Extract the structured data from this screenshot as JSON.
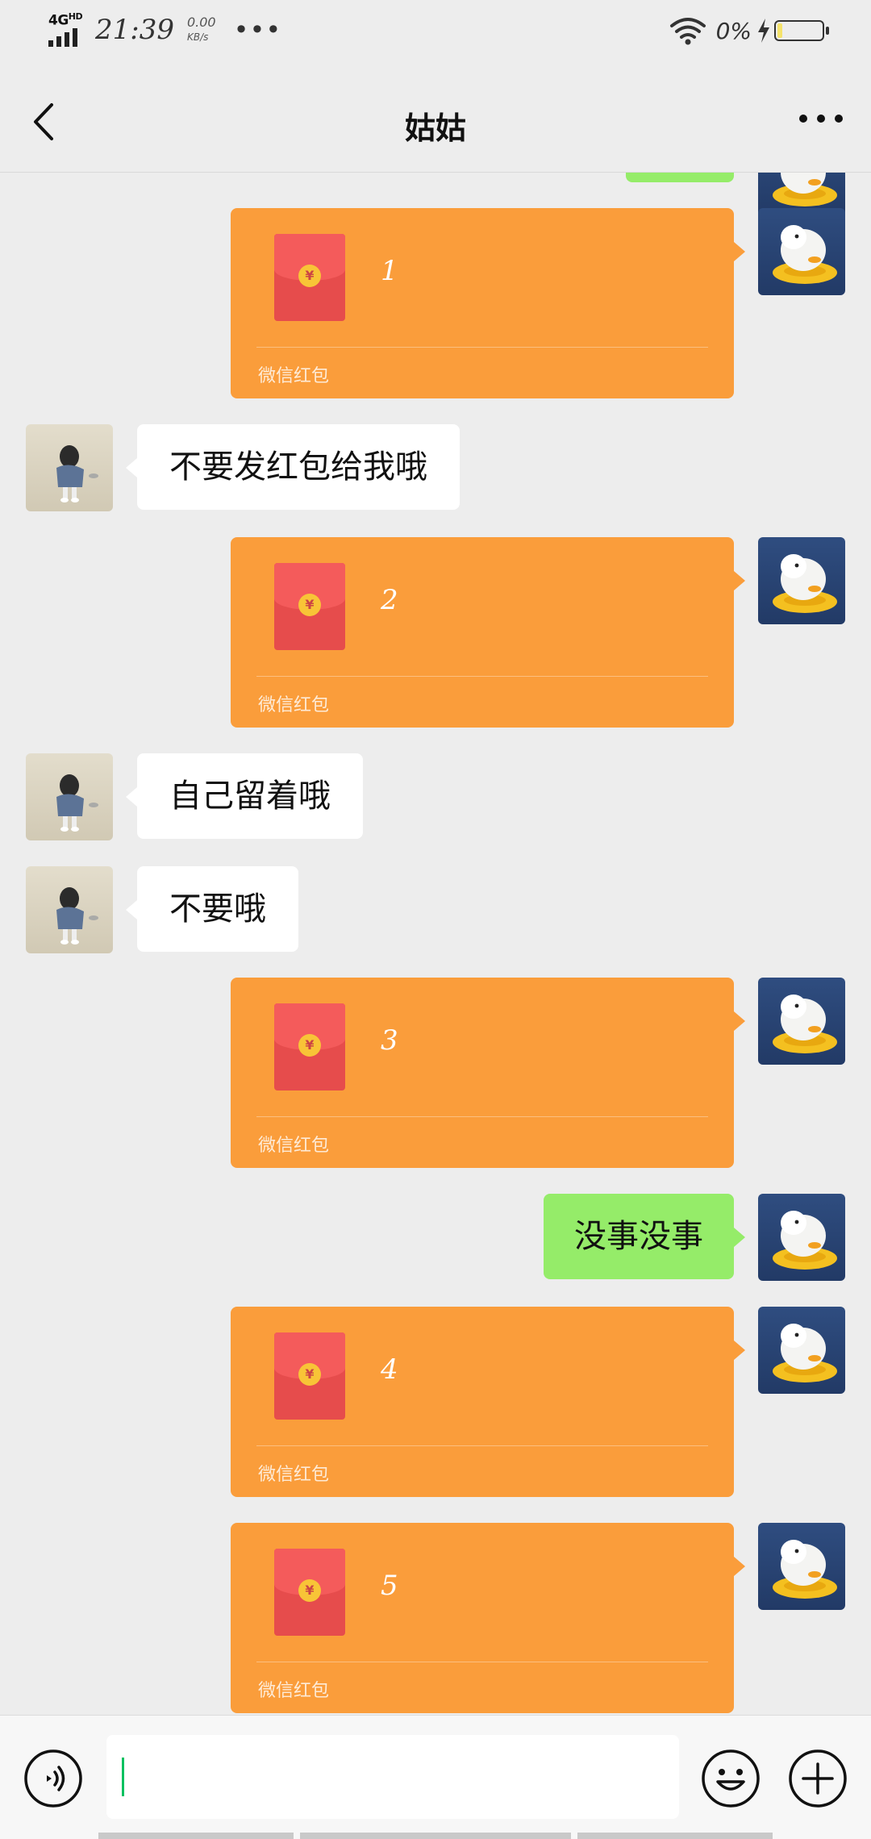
{
  "status_bar": {
    "network": "4G",
    "network_sub": "HD",
    "time": "21:39",
    "speed_value": "0.00",
    "speed_unit": "KB/s",
    "more": "•••",
    "battery_percent": "0%"
  },
  "header": {
    "back_icon": "chevron-left-icon",
    "title": "姑姑",
    "more_icon": "more-dots-icon"
  },
  "messages": [
    {
      "sender": "me",
      "type": "red_packet",
      "amount": "1",
      "label": "微信红包"
    },
    {
      "sender": "them",
      "type": "text",
      "text": "不要发红包给我哦"
    },
    {
      "sender": "me",
      "type": "red_packet",
      "amount": "2",
      "label": "微信红包"
    },
    {
      "sender": "them",
      "type": "text",
      "text": "自己留着哦"
    },
    {
      "sender": "them",
      "type": "text",
      "text": "不要哦"
    },
    {
      "sender": "me",
      "type": "red_packet",
      "amount": "3",
      "label": "微信红包"
    },
    {
      "sender": "me",
      "type": "text",
      "text": "没事没事"
    },
    {
      "sender": "me",
      "type": "red_packet",
      "amount": "4",
      "label": "微信红包"
    },
    {
      "sender": "me",
      "type": "red_packet",
      "amount": "5",
      "label": "微信红包"
    }
  ],
  "input_bar": {
    "voice_icon": "voice-icon",
    "input_value": "",
    "emoji_icon": "emoji-icon",
    "plus_icon": "plus-icon"
  },
  "colors": {
    "background": "#ededed",
    "red_packet": "#fa9d3b",
    "my_bubble": "#95ec69",
    "their_bubble": "#ffffff",
    "caret": "#07c160"
  }
}
